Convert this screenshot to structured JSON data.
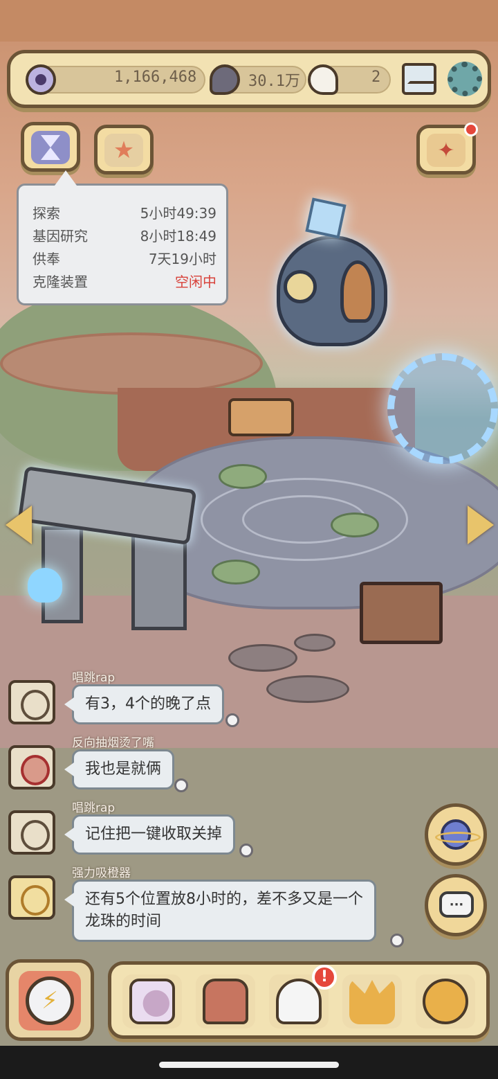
{
  "resources": {
    "eye_points": "1,166,468",
    "dark_bubbles": "30.1万",
    "light_bubbles": "2"
  },
  "timers": [
    {
      "label": "探索",
      "value": "5小时49:39"
    },
    {
      "label": "基因研究",
      "value": "8小时18:49"
    },
    {
      "label": "供奉",
      "value": "7天19小时"
    },
    {
      "label": "克隆装置",
      "value": "空闲中"
    }
  ],
  "chat": [
    {
      "name": "唱跳rap",
      "text": "有3，4个的晚了点"
    },
    {
      "name": "反向抽烟烫了嘴",
      "text": "我也是就俩"
    },
    {
      "name": "唱跳rap",
      "text": "记住把一键收取关掉"
    },
    {
      "name": "强力吸橙器",
      "line1": "还有5个位置放8小时的，差不多又是一个",
      "line2": "龙珠的时间"
    }
  ],
  "bottom_nav": {
    "alert_mark": "!"
  },
  "colors": {
    "panel_bg": "#f2e2b3",
    "panel_border": "#6b5436",
    "idle_red": "#d8413a",
    "badge_red": "#e5473b"
  },
  "icons": [
    "eye-icon",
    "dark-bubble-icon",
    "light-bubble-icon",
    "mail-icon",
    "gear-icon",
    "hourglass-icon",
    "starfish-icon",
    "party-popper-icon",
    "planet-icon",
    "chat-icon",
    "compass-lightning-icon",
    "snail-icon",
    "backpack-icon",
    "bust-icon",
    "pyramid-eye-icon",
    "coin-icon"
  ]
}
